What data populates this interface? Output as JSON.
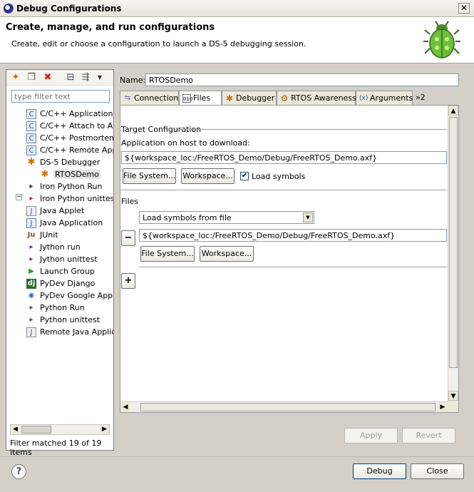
{
  "window": {
    "title": "Debug Configurations",
    "close": "✕"
  },
  "banner": {
    "heading": "Create, manage, and run configurations",
    "description": "Create, edit or choose a configuration to launch a DS-5 debugging session."
  },
  "left": {
    "filter_placeholder": "type filter text",
    "items": [
      {
        "label": "C/C++ Application",
        "icon": "C"
      },
      {
        "label": "C/C++ Attach to Ap",
        "icon": "C"
      },
      {
        "label": "C/C++ Postmortem",
        "icon": "C"
      },
      {
        "label": "C/C++ Remote App",
        "icon": "C"
      },
      {
        "label": "DS-5 Debugger",
        "icon": "✱"
      },
      {
        "label": "RTOSDemo",
        "icon": "✱"
      },
      {
        "label": "Iron Python Run",
        "icon": "▸"
      },
      {
        "label": "Iron Python unittest",
        "icon": "▸"
      },
      {
        "label": "Java Applet",
        "icon": "J"
      },
      {
        "label": "Java Application",
        "icon": "J"
      },
      {
        "label": "JUnit",
        "icon": "Ju"
      },
      {
        "label": "Jython run",
        "icon": "▸"
      },
      {
        "label": "Jython unittest",
        "icon": "▸"
      },
      {
        "label": "Launch Group",
        "icon": "▶"
      },
      {
        "label": "PyDev Django",
        "icon": "dj"
      },
      {
        "label": "PyDev Google App E",
        "icon": "◉"
      },
      {
        "label": "Python Run",
        "icon": "▸"
      },
      {
        "label": "Python unittest",
        "icon": "▸"
      },
      {
        "label": "Remote Java Applica",
        "icon": "J"
      }
    ],
    "filter_status": "Filter matched 19 of 19 items"
  },
  "name": {
    "label": "Name:",
    "value": "RTOSDemo"
  },
  "tabs": [
    "Connection",
    "Files",
    "Debugger",
    "RTOS Awareness",
    "Arguments",
    "»2"
  ],
  "files_tab": {
    "target_heading": "Target Configuration",
    "app_label": "Application on host to download:",
    "app_path": "${workspace_loc:/FreeRTOS_Demo/Debug/FreeRTOS_Demo.axf}",
    "file_system_btn": "File System...",
    "workspace_btn": "Workspace...",
    "load_symbols_label": "Load symbols",
    "load_symbols_checked": "✔",
    "files_heading": "Files",
    "combo_value": "Load symbols from file",
    "file_path": "${workspace_loc:/FreeRTOS_Demo/Debug/FreeRTOS_Demo.axf}",
    "remove_btn": "−",
    "add_btn": "+"
  },
  "buttons": {
    "apply": "Apply",
    "revert": "Revert",
    "debug": "Debug",
    "close": "Close",
    "help": "?"
  }
}
